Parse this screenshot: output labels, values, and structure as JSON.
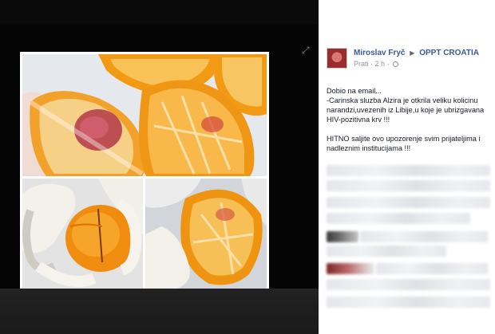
{
  "post": {
    "author": "Miroslav Fryč",
    "arrow": "▶",
    "target": "OPPT CROATIA",
    "follow_label": "Prati",
    "separator": "·",
    "time": "2 h",
    "paragraph1_line1": "Dobio na email...",
    "paragraph1_line2": "-Carinska sluzba Alzira je otkrila veliku kolicinu narandzi,uvezenih iz Libije,u koje je ubrizgavana HIV-pozitivna krv !!!",
    "paragraph2": "HITNO saljite ovo upozorenje svim prijateljima i nadleznim institucijama !!!"
  },
  "viewer": {
    "expand_icon": "⤢"
  },
  "colors": {
    "link": "#3b5998",
    "meta": "#90949c",
    "text": "#141823"
  }
}
